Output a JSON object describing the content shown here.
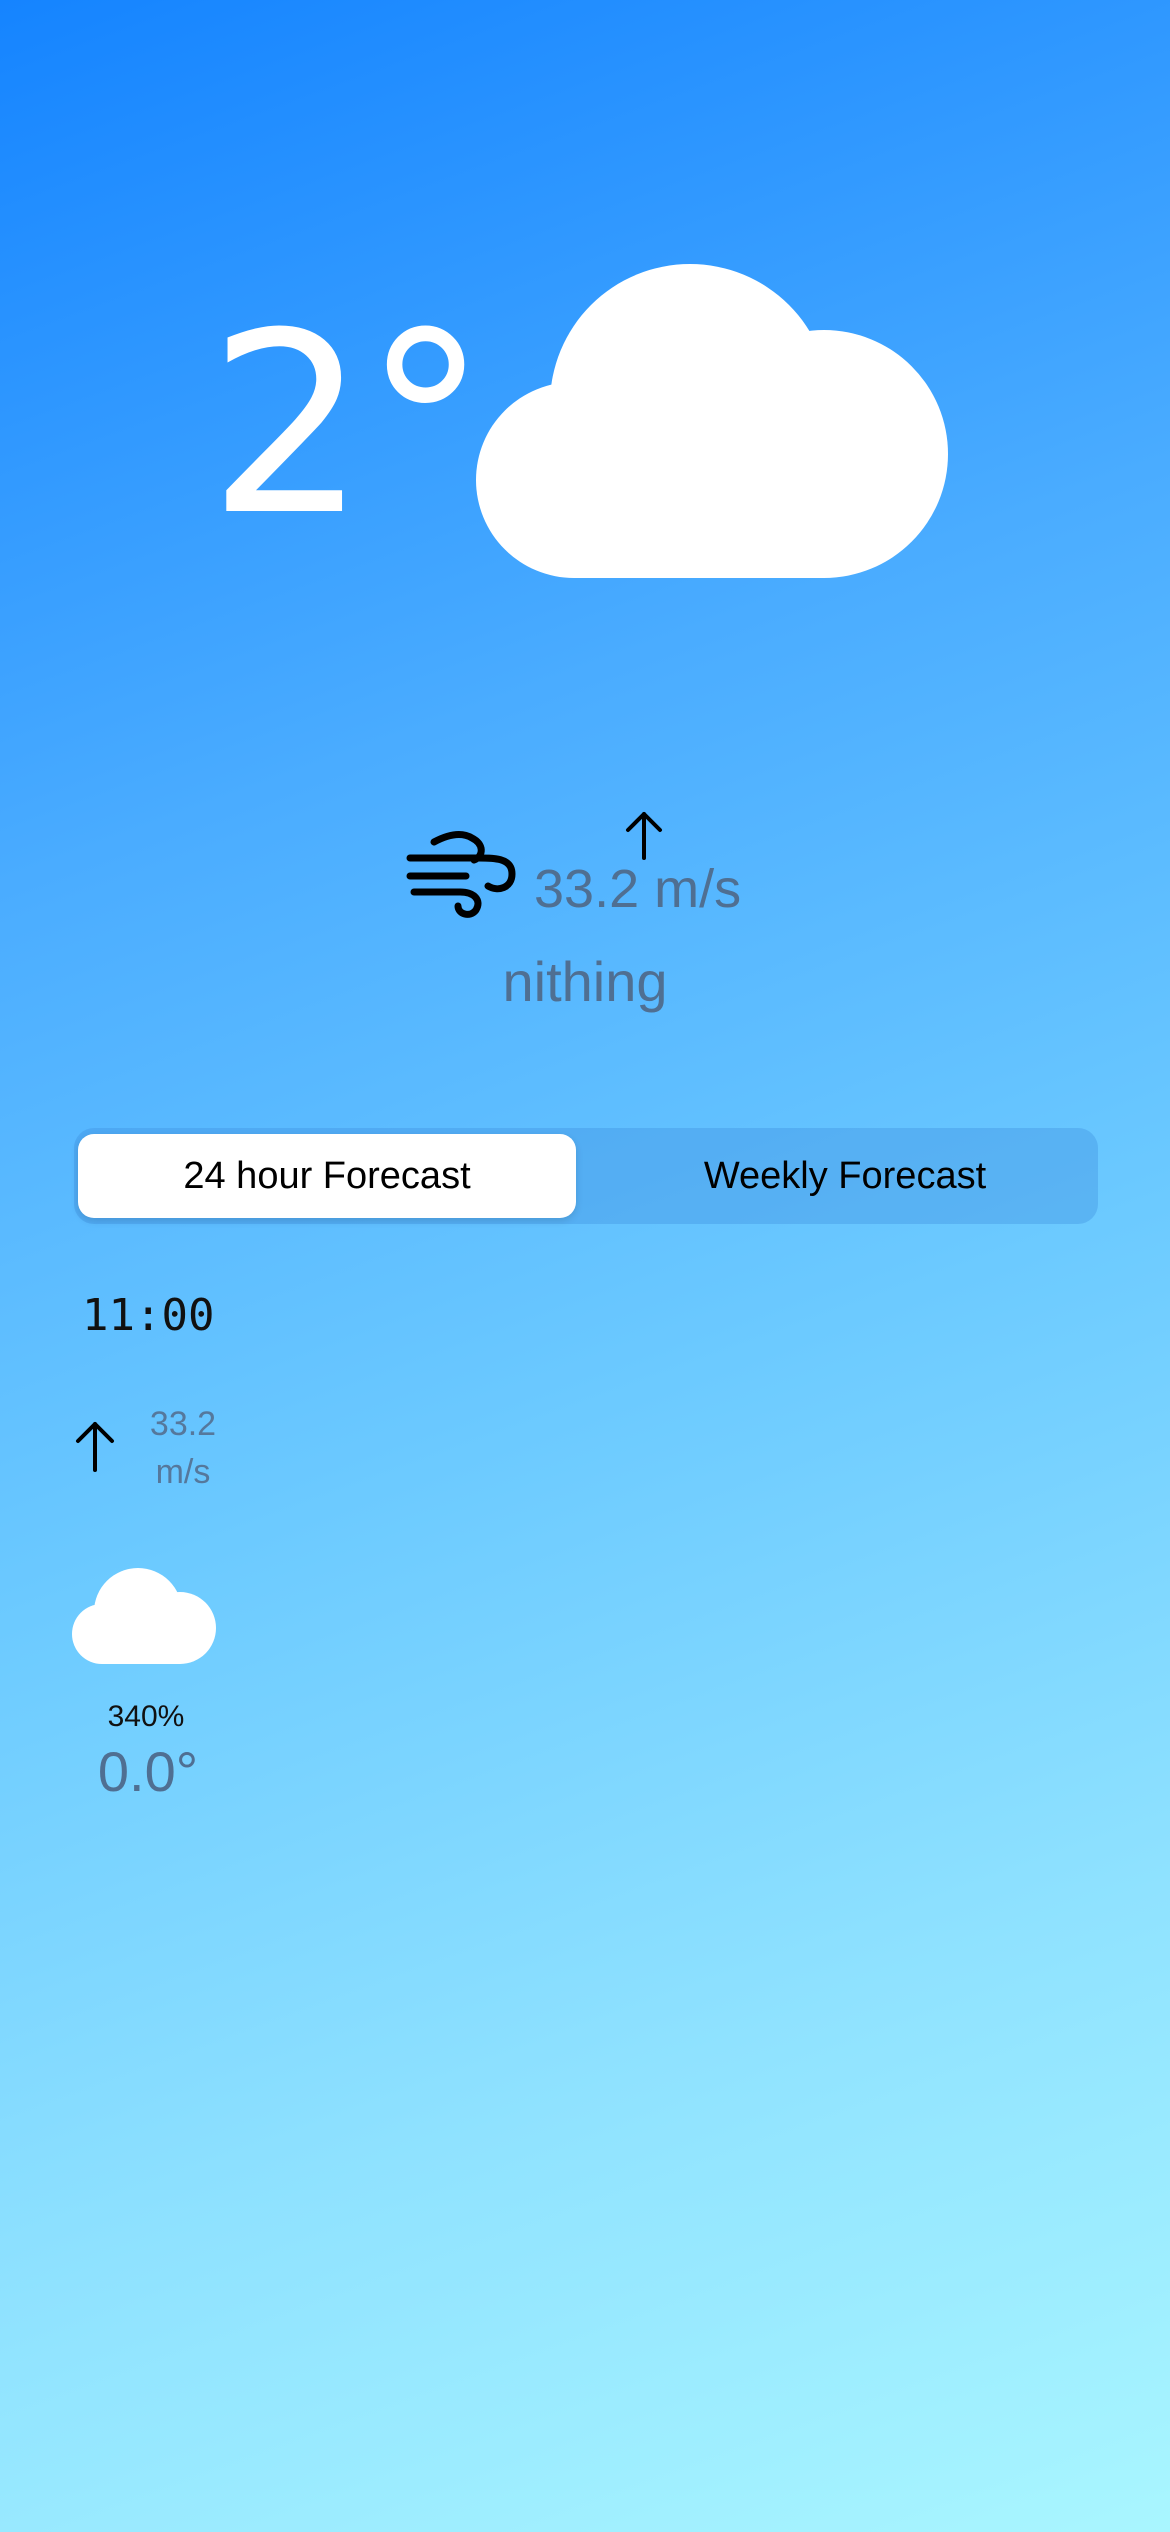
{
  "current": {
    "temperature": "2°",
    "condition_icon": "cloud-icon",
    "wind_icon": "wind-icon",
    "wind_direction_icon": "arrow-up-icon",
    "wind_speed": "33.2 m/s",
    "description": "nithing"
  },
  "forecast_tabs": [
    {
      "label": "24 hour Forecast",
      "selected": true
    },
    {
      "label": "Weekly Forecast",
      "selected": false
    }
  ],
  "hourly": [
    {
      "time": "11:00",
      "wind_direction_icon": "arrow-up-icon",
      "wind_speed_value": "33.2",
      "wind_speed_unit": "m/s",
      "condition_icon": "cloud-icon",
      "precipitation": "340%",
      "temperature": "0.0°"
    }
  ],
  "colors": {
    "gradient_top": "#1584ff",
    "gradient_bottom": "#a9f6ff",
    "secondary_text": "#4f6f92",
    "cloud": "#ffffff"
  }
}
